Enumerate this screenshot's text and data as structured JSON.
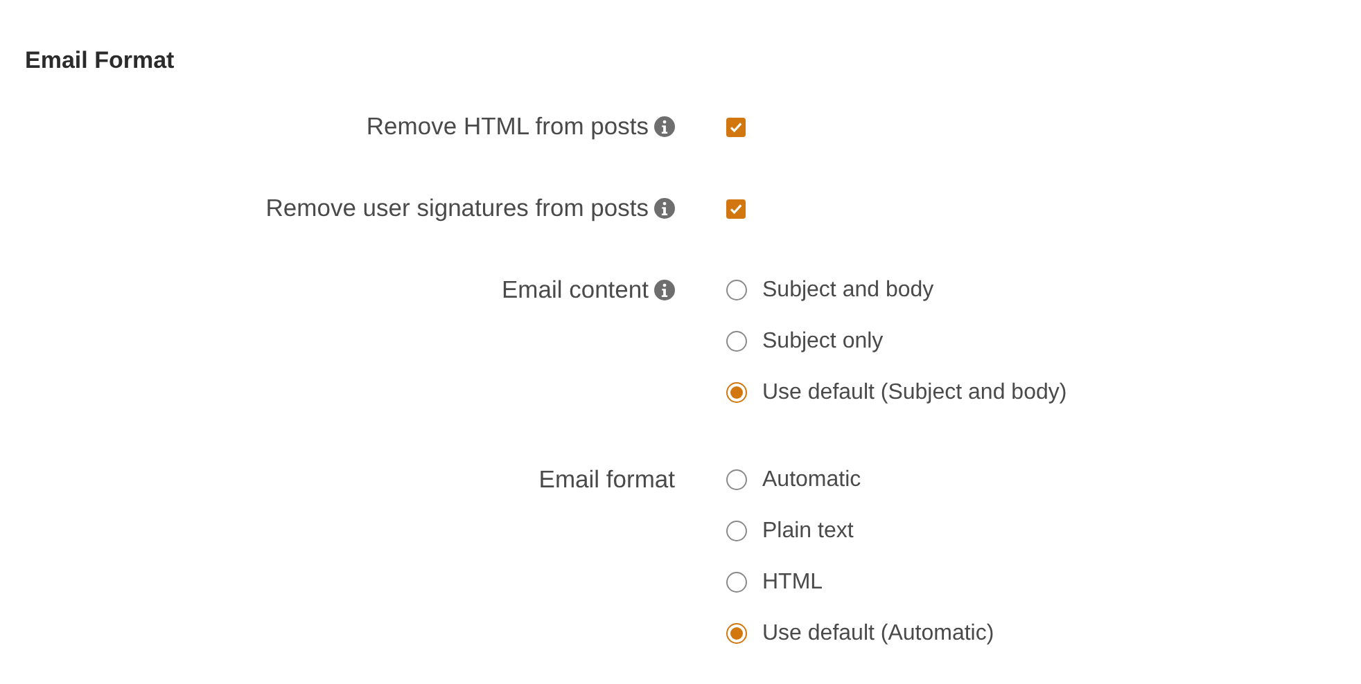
{
  "heading": "Email Format",
  "settings": [
    {
      "kind": "checkbox",
      "label": "Remove HTML from posts",
      "info": true,
      "checked": true
    },
    {
      "kind": "checkbox",
      "label": "Remove user signatures from posts",
      "info": true,
      "checked": true
    },
    {
      "kind": "radio",
      "label": "Email content",
      "info": true,
      "options": [
        {
          "label": "Subject and body",
          "selected": false
        },
        {
          "label": "Subject only",
          "selected": false
        },
        {
          "label": "Use default (Subject and body)",
          "selected": true
        }
      ]
    },
    {
      "kind": "radio",
      "label": "Email format",
      "info": false,
      "options": [
        {
          "label": "Automatic",
          "selected": false
        },
        {
          "label": "Plain text",
          "selected": false
        },
        {
          "label": "HTML",
          "selected": false
        },
        {
          "label": "Use default (Automatic)",
          "selected": true
        }
      ]
    }
  ]
}
